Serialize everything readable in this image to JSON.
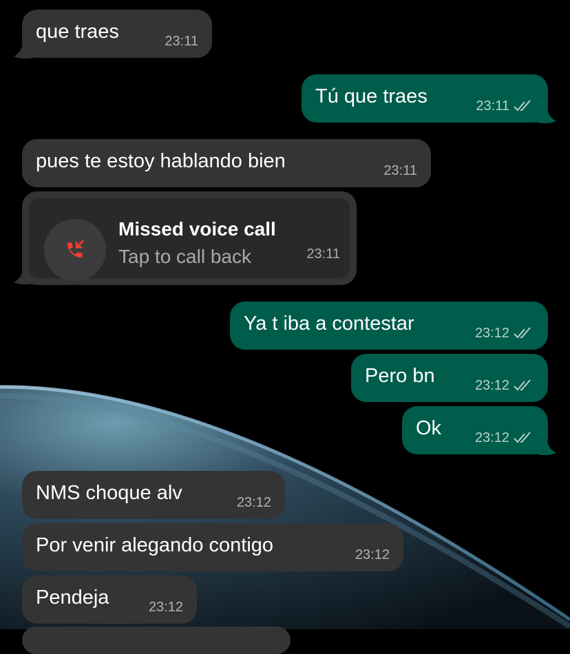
{
  "colors": {
    "incoming_bubble": "#343434",
    "outgoing_bubble": "#005c4b",
    "missed_call_red": "#ff3b30",
    "background": "#000000"
  },
  "messages": [
    {
      "text": "que traes",
      "time": "23:11"
    },
    {
      "text": "Tú que traes",
      "time": "23:11"
    },
    {
      "text": "pues te estoy hablando bien",
      "time": "23:11"
    },
    {
      "text": "Ya t iba a contestar",
      "time": "23:12"
    },
    {
      "text": "Pero bn",
      "time": "23:12"
    },
    {
      "text": "Ok",
      "time": "23:12"
    },
    {
      "text": "NMS choque alv",
      "time": "23:12"
    },
    {
      "text": "Por venir alegando contigo",
      "time": "23:12"
    },
    {
      "text": "Pendeja",
      "time": "23:12"
    }
  ],
  "missed_call": {
    "title": "Missed voice call",
    "subtitle": "Tap to call back",
    "time": "23:11",
    "icon": "missed-call-icon"
  },
  "icons": {
    "read_receipt": "double-check-icon"
  }
}
